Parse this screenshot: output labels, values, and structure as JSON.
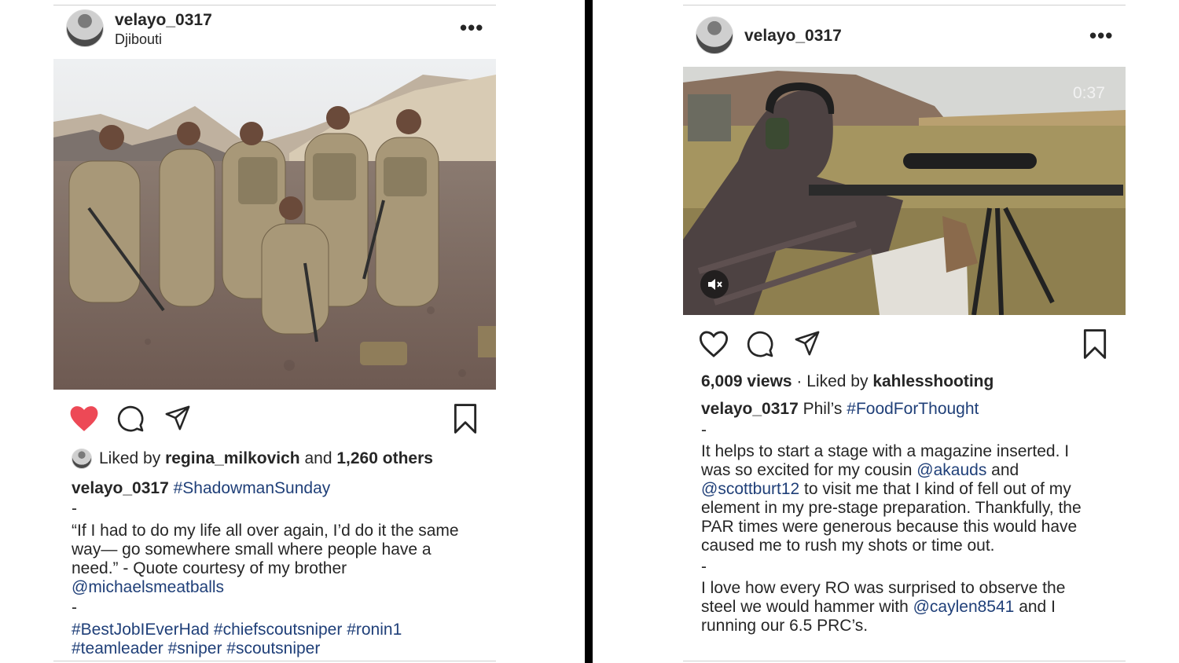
{
  "left_post": {
    "username": "velayo_0317",
    "location": "Djibouti",
    "more_label": "•••",
    "liked_prefix": "Liked by ",
    "liked_user": "regina_milkovich",
    "liked_and": " and ",
    "liked_others": "1,260 others",
    "caption_user": "velayo_0317",
    "caption_tag": "#ShadowmanSunday",
    "dash1": "-",
    "quote_line1": "“If I had to do my life all over again, I’d do it the same",
    "quote_line2": "way— go somewhere small where people have a",
    "quote_line3": "need.” - Quote courtesy of my brother",
    "quote_mention": "@michaelsmeatballs",
    "dash2": "-",
    "tags_line1": "#BestJobIEverHad #chiefscoutsniper #ronin1",
    "tags_line2": "#teamleader #sniper #scoutsniper",
    "liked_state": "liked",
    "icons": [
      "heart-filled-icon",
      "comment-icon",
      "share-icon",
      "bookmark-icon"
    ]
  },
  "right_post": {
    "username": "velayo_0317",
    "more_label": "•••",
    "video_time": "0:37",
    "views": "6,009 views",
    "liked_sep": " · Liked by ",
    "liked_user": "kahlesshooting",
    "caption_user": "velayo_0317",
    "caption_text": " Phil’s ",
    "caption_tag": "#FoodForThought",
    "dash1": "-",
    "p1_line1": "It helps to start a stage with a magazine inserted. I",
    "p1_line2_a": "was so excited for my cousin ",
    "p1_line2_mention": "@akauds",
    "p1_line2_b": " and",
    "p1_line3_mention": "@scottburt12",
    "p1_line3_b": " to visit me that I kind of fell out of my",
    "p1_line4": "element in my pre-stage preparation. Thankfully, the",
    "p1_line5": "PAR times were generous because this would have",
    "p1_line6": "caused me to rush my shots or time out.",
    "dash2": "-",
    "p2_line1": "I love how every RO was surprised to observe the",
    "p2_line2_a": "steel we would hammer with ",
    "p2_line2_mention": "@caylen8541",
    "p2_line2_b": " and I",
    "p2_line3": "running our 6.5 PRC’s.",
    "icons": [
      "heart-outline-icon",
      "comment-icon",
      "share-icon",
      "bookmark-icon",
      "mute-icon"
    ]
  }
}
